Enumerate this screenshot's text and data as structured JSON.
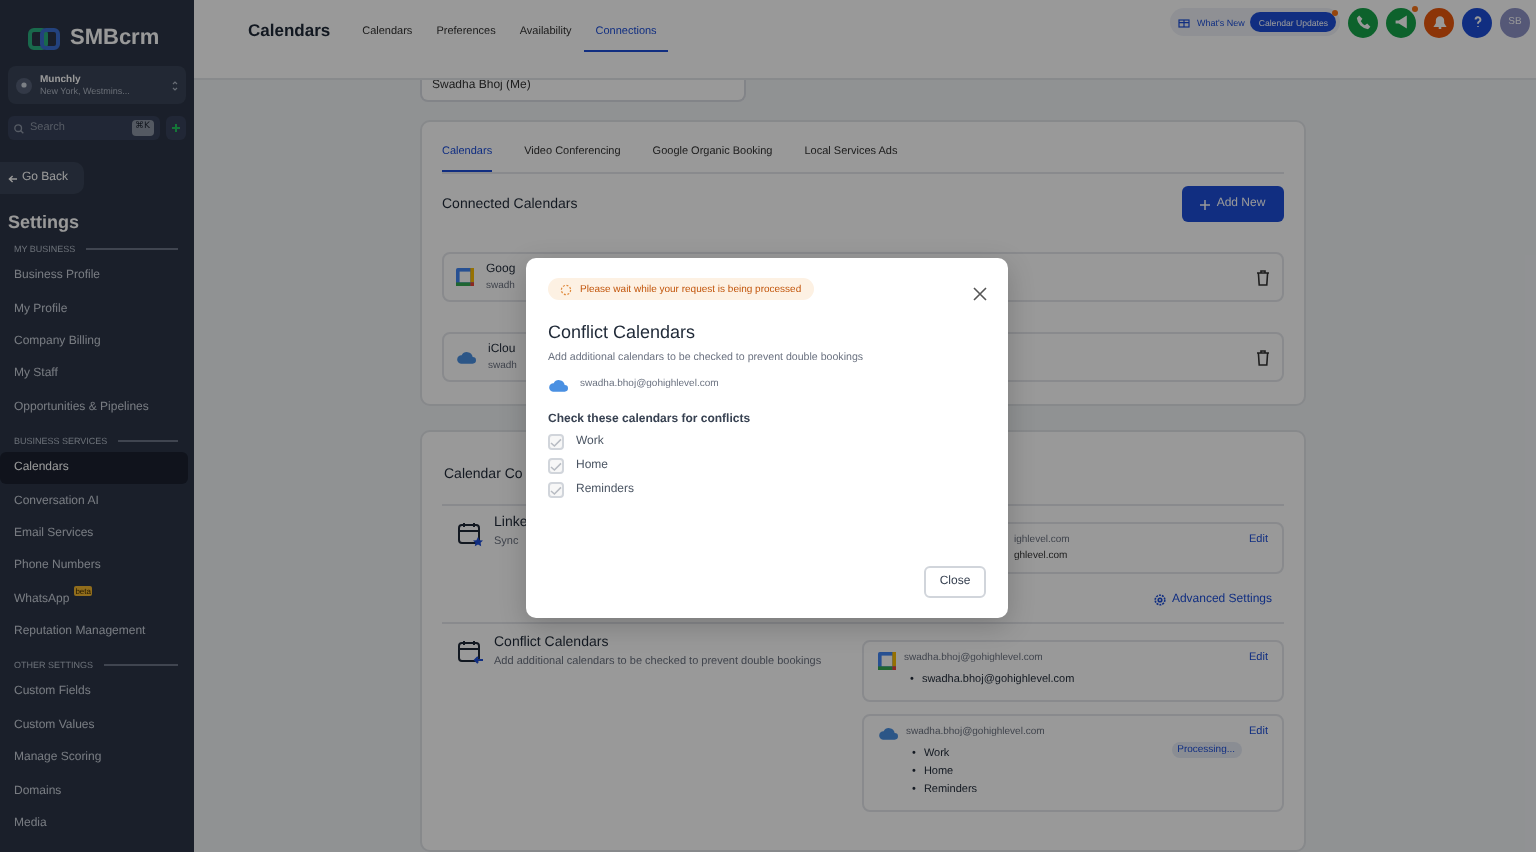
{
  "sidebar": {
    "logo": "SMBcrm",
    "account": {
      "name": "Munchly",
      "location": "New York, Westmins..."
    },
    "search": {
      "placeholder": "Search",
      "shortcut": "⌘K"
    },
    "back_button": "Go Back",
    "title": "Settings",
    "sections": [
      {
        "heading": "MY BUSINESS",
        "items": [
          {
            "label": "Business Profile",
            "selected": false
          },
          {
            "label": "My Profile",
            "selected": false
          },
          {
            "label": "Company Billing",
            "selected": false
          },
          {
            "label": "My Staff",
            "selected": false
          },
          {
            "label": "Opportunities & Pipelines",
            "selected": false
          }
        ]
      },
      {
        "heading": "BUSINESS SERVICES",
        "items": [
          {
            "label": "Calendars",
            "selected": true
          },
          {
            "label": "Conversation AI",
            "selected": false
          },
          {
            "label": "Email Services",
            "selected": false
          },
          {
            "label": "Phone Numbers",
            "selected": false
          },
          {
            "label": "WhatsApp",
            "selected": false,
            "badge": "beta"
          },
          {
            "label": "Reputation Management",
            "selected": false
          }
        ]
      },
      {
        "heading": "OTHER SETTINGS",
        "items": [
          {
            "label": "Custom Fields",
            "selected": false
          },
          {
            "label": "Custom Values",
            "selected": false
          },
          {
            "label": "Manage Scoring",
            "selected": false
          },
          {
            "label": "Domains",
            "selected": false
          },
          {
            "label": "Media",
            "selected": false
          }
        ]
      }
    ]
  },
  "header": {
    "title": "Calendars",
    "tabs": [
      {
        "label": "Calendars",
        "selected": false
      },
      {
        "label": "Preferences",
        "selected": false
      },
      {
        "label": "Availability",
        "selected": false
      },
      {
        "label": "Connections",
        "selected": true
      }
    ],
    "whats_new": "What's New",
    "updates_button": "Calendar Updates",
    "action_icons": [
      {
        "kind": "phone",
        "dot": false
      },
      {
        "kind": "megaphone",
        "dot": true
      },
      {
        "kind": "bell",
        "dot": false
      },
      {
        "kind": "help",
        "dot": false
      }
    ],
    "avatar": "SB"
  },
  "staff_select": {
    "value": "Swadha Bhoj (Me)"
  },
  "connections": {
    "tabs": [
      {
        "label": "Calendars",
        "selected": true
      },
      {
        "label": "Video Conferencing",
        "selected": false
      },
      {
        "label": "Google Organic Booking",
        "selected": false
      },
      {
        "label": "Local Services Ads",
        "selected": false
      }
    ],
    "heading": "Connected Calendars",
    "add_button": "Add New",
    "accounts": [
      {
        "kind": "google",
        "name": "Goog",
        "email": "swadh"
      },
      {
        "kind": "icloud",
        "name": "iClou",
        "email": "swadh"
      }
    ]
  },
  "configuration": {
    "heading": "Calendar Co",
    "linked": {
      "title": "Linke",
      "description": "Sync",
      "email": "ighlevel.com",
      "items": [
        "ghlevel.com"
      ],
      "edit": "Edit",
      "advanced": "Advanced Settings"
    },
    "conflict": {
      "title": "Conflict Calendars",
      "description": "Add additional calendars to be checked to prevent double bookings",
      "accounts": [
        {
          "kind": "google",
          "email": "swadha.bhoj@gohighlevel.com",
          "items": [
            "swadha.bhoj@gohighlevel.com"
          ],
          "edit": "Edit"
        },
        {
          "kind": "icloud",
          "email": "swadha.bhoj@gohighlevel.com",
          "status": "Processing...",
          "items": [
            "Work",
            "Home",
            "Reminders"
          ],
          "edit": "Edit"
        }
      ],
      "marker": "•"
    }
  },
  "modal": {
    "notice": "Please wait while your request is being processed",
    "title": "Conflict Calendars",
    "description": "Add additional calendars to be checked to prevent double bookings",
    "account": {
      "kind": "icloud",
      "email": "swadha.bhoj@gohighlevel.com"
    },
    "subheading": "Check these calendars for conflicts",
    "calendars": [
      {
        "label": "Work",
        "checked": true,
        "disabled": true
      },
      {
        "label": "Home",
        "checked": true,
        "disabled": true
      },
      {
        "label": "Reminders",
        "checked": true,
        "disabled": true
      }
    ],
    "close_button": "Close"
  }
}
